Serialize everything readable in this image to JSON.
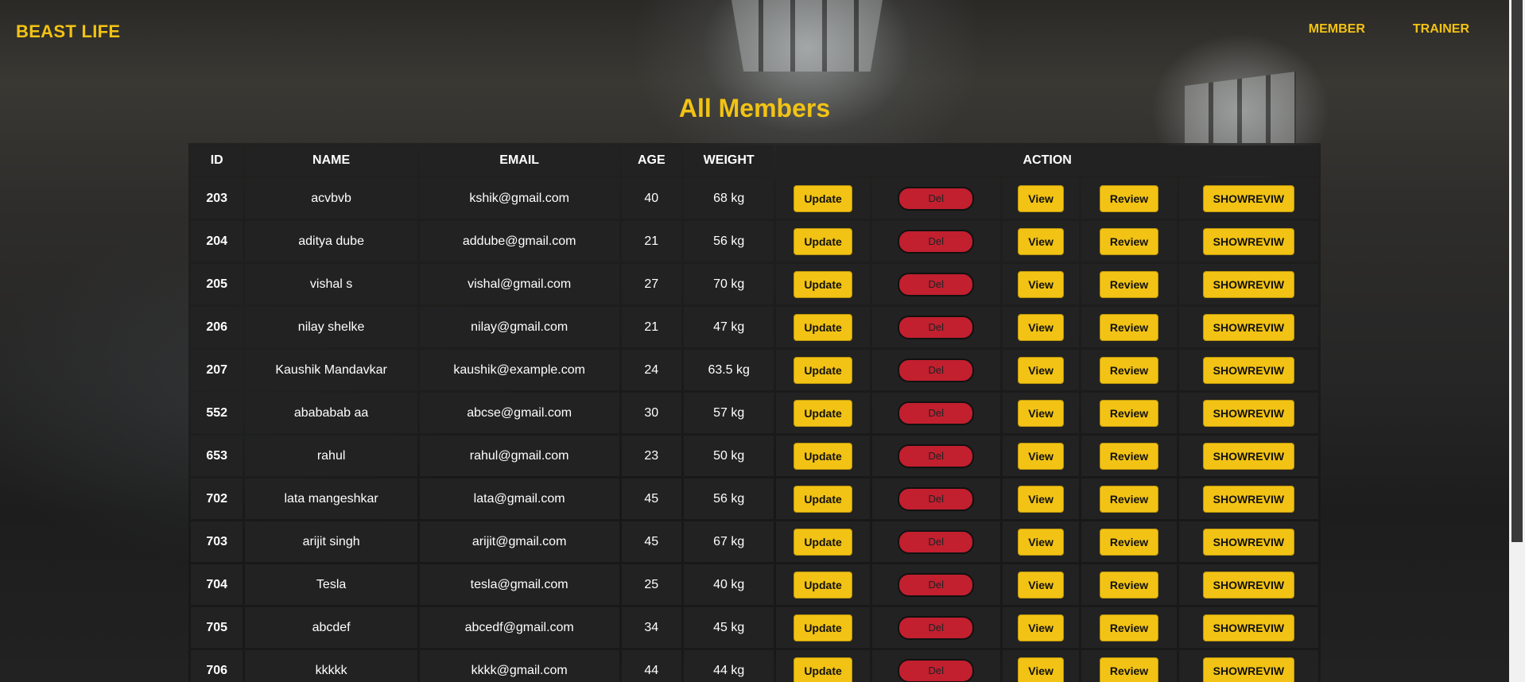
{
  "brand": "BEAST LIFE",
  "nav": [
    {
      "label": "MEMBER"
    },
    {
      "label": "TRAINER"
    }
  ],
  "page_title": "All Members",
  "table": {
    "headers": [
      "ID",
      "NAME",
      "EMAIL",
      "AGE",
      "WEIGHT",
      "ACTION"
    ],
    "actions": {
      "update": "Update",
      "delete": "Del",
      "view": "View",
      "review": "Review",
      "show_review": "SHOWREVIW"
    },
    "rows": [
      {
        "id": "203",
        "name": "acvbvb",
        "email": "kshik@gmail.com",
        "age": "40",
        "weight": "68 kg"
      },
      {
        "id": "204",
        "name": "aditya dube",
        "email": "addube@gmail.com",
        "age": "21",
        "weight": "56 kg"
      },
      {
        "id": "205",
        "name": "vishal s",
        "email": "vishal@gmail.com",
        "age": "27",
        "weight": "70 kg"
      },
      {
        "id": "206",
        "name": "nilay shelke",
        "email": "nilay@gmail.com",
        "age": "21",
        "weight": "47 kg"
      },
      {
        "id": "207",
        "name": "Kaushik Mandavkar",
        "email": "kaushik@example.com",
        "age": "24",
        "weight": "63.5 kg"
      },
      {
        "id": "552",
        "name": "abababab aa",
        "email": "abcse@gmail.com",
        "age": "30",
        "weight": "57 kg"
      },
      {
        "id": "653",
        "name": "rahul",
        "email": "rahul@gmail.com",
        "age": "23",
        "weight": "50 kg"
      },
      {
        "id": "702",
        "name": "lata mangeshkar",
        "email": "lata@gmail.com",
        "age": "45",
        "weight": "56 kg"
      },
      {
        "id": "703",
        "name": "arijit singh",
        "email": "arijit@gmail.com",
        "age": "45",
        "weight": "67 kg"
      },
      {
        "id": "704",
        "name": "Tesla",
        "email": "tesla@gmail.com",
        "age": "25",
        "weight": "40 kg"
      },
      {
        "id": "705",
        "name": "abcdef",
        "email": "abcedf@gmail.com",
        "age": "34",
        "weight": "45 kg"
      },
      {
        "id": "706",
        "name": "kkkkk",
        "email": "kkkk@gmail.com",
        "age": "44",
        "weight": "44 kg"
      }
    ]
  },
  "colors": {
    "accent": "#f2c314",
    "danger": "#c21f2f",
    "cell_bg": "#222222"
  }
}
